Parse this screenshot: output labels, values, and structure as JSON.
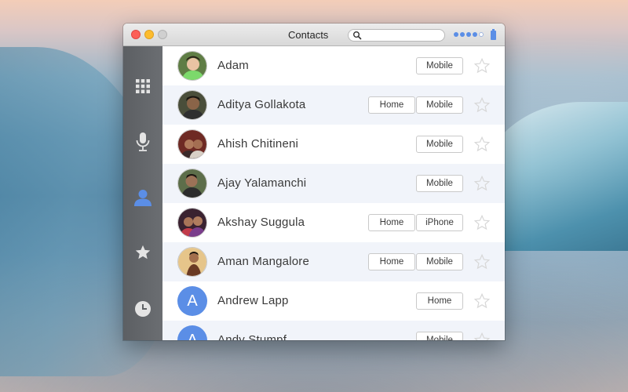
{
  "window": {
    "title": "Contacts"
  },
  "search": {
    "placeholder": ""
  },
  "status": {
    "signal_filled": 4,
    "signal_empty": 1,
    "accent": "#5b8ee6"
  },
  "sidebar": {
    "items": [
      {
        "name": "keypad",
        "icon": "keypad-icon",
        "active": false
      },
      {
        "name": "voicemail",
        "icon": "microphone-icon",
        "active": false
      },
      {
        "name": "contacts",
        "icon": "person-icon",
        "active": true
      },
      {
        "name": "favorites",
        "icon": "star-icon",
        "active": false
      },
      {
        "name": "recents",
        "icon": "clock-icon",
        "active": false
      }
    ]
  },
  "contacts": [
    {
      "name": "Adam",
      "phones": [
        "Mobile"
      ],
      "avatar": "photo"
    },
    {
      "name": "Aditya Gollakota",
      "phones": [
        "Home",
        "Mobile"
      ],
      "avatar": "photo"
    },
    {
      "name": "Ahish Chitineni",
      "phones": [
        "Mobile"
      ],
      "avatar": "photo"
    },
    {
      "name": "Ajay Yalamanchi",
      "phones": [
        "Mobile"
      ],
      "avatar": "photo"
    },
    {
      "name": "Akshay Suggula",
      "phones": [
        "Home",
        "iPhone"
      ],
      "avatar": "photo"
    },
    {
      "name": "Aman Mangalore",
      "phones": [
        "Home",
        "Mobile"
      ],
      "avatar": "photo"
    },
    {
      "name": "Andrew Lapp",
      "phones": [
        "Home"
      ],
      "avatar": "A"
    },
    {
      "name": "Andy Stumpf",
      "phones": [
        "Mobile"
      ],
      "avatar": "A"
    }
  ]
}
